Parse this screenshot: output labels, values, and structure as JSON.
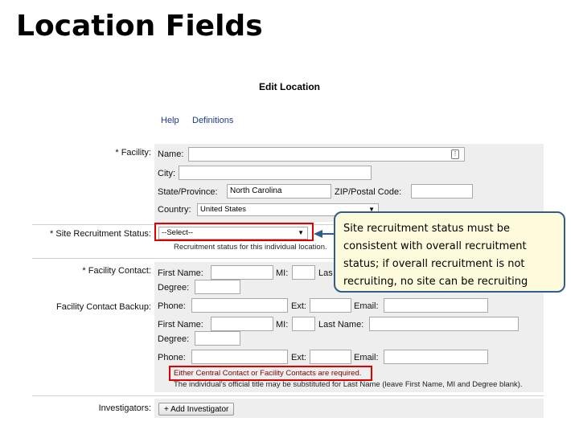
{
  "slide": {
    "title": "Location Fields"
  },
  "form": {
    "title": "Edit Location",
    "links": {
      "help": "Help",
      "definitions": "Definitions"
    },
    "facility": {
      "label": "* Facility:",
      "name_label": "Name:",
      "city_label": "City:",
      "state_label": "State/Province:",
      "state_value": "North Carolina",
      "zip_label": "ZIP/Postal Code:",
      "country_label": "Country:",
      "country_value": "United States"
    },
    "recruitment": {
      "label": "* Site Recruitment Status:",
      "value": "--Select--",
      "hint": "Recruitment status for this individual location."
    },
    "contact": {
      "label": "* Facility Contact:",
      "first_name_label": "First Name:",
      "mi_label": "MI:",
      "last_name_label": "Las",
      "degree_label": "Degree:"
    },
    "backup": {
      "label": "Facility Contact Backup:",
      "phone_label": "Phone:",
      "ext_label": "Ext:",
      "email_label": "Email:",
      "first_name_label": "First Name:",
      "mi_label": "MI:",
      "last_name_label": "Last Name:",
      "degree_label": "Degree:",
      "phone2_label": "Phone:",
      "ext2_label": "Ext:",
      "email2_label": "Email:",
      "required_note": "Either Central Contact or Facility Contacts are required.",
      "title_note": "The individual's official title may be substituted for Last Name (leave First Name, MI and Degree blank)."
    },
    "investigators": {
      "label": "Investigators:",
      "add_button": "+ Add Investigator"
    }
  },
  "callout": {
    "text": "Site recruitment status must be consistent with overall recruitment status; if overall recruitment is not recruiting, no site can be recruiting"
  },
  "colors": {
    "highlight": "#e00000",
    "callout_border": "#2f5d8c",
    "callout_fill": "#fefbdc",
    "link": "#1a3a8c"
  }
}
